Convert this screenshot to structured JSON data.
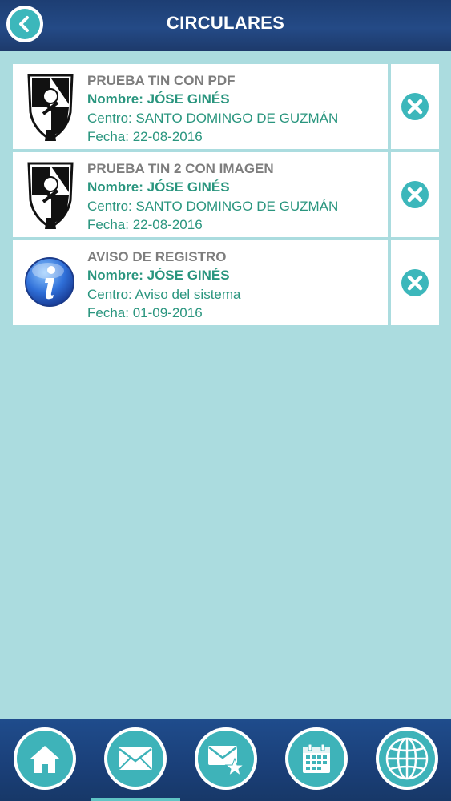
{
  "header": {
    "title": "CIRCULARES",
    "back_icon": "chevron-left-icon"
  },
  "circulares": [
    {
      "title": "PRUEBA TIN CON PDF",
      "nombre": "Nombre: JÓSE GINÉS",
      "centro": "Centro: SANTO DOMINGO DE GUZMÁN",
      "fecha": "Fecha: 22-08-2016",
      "icon": "dominican-shield-icon"
    },
    {
      "title": "PRUEBA TIN 2 CON IMAGEN",
      "nombre": "Nombre: JÓSE GINÉS",
      "centro": "Centro: SANTO DOMINGO DE GUZMÁN",
      "fecha": "Fecha: 22-08-2016",
      "icon": "dominican-shield-icon"
    },
    {
      "title": "AVISO DE REGISTRO",
      "nombre": "Nombre: JÓSE GINÉS",
      "centro": "Centro: Aviso del sistema",
      "fecha": "Fecha: 01-09-2016",
      "icon": "info-icon"
    }
  ],
  "delete_icon": "close-circle-icon",
  "tabbar": {
    "tabs": [
      "home-icon",
      "mail-icon",
      "mail-star-icon",
      "calendar-icon",
      "globe-icon"
    ],
    "active_index": 1
  },
  "colors": {
    "header_bg": "#1d3e73",
    "page_bg": "#abdcdf",
    "accent_teal": "#3cb7bb",
    "title_gray": "#7d7d7d",
    "text_green": "#29957e"
  }
}
